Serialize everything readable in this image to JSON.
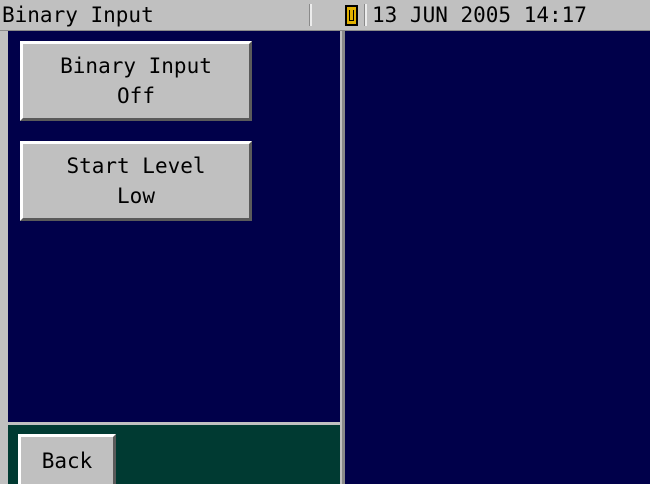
{
  "title_bar": {
    "title": "Binary Input",
    "status_icon": "drive-indicator-icon",
    "datetime": "13 JUN 2005 14:17"
  },
  "menu": {
    "binary_input": {
      "line1": "Binary Input",
      "line2": "Off"
    },
    "start_level": {
      "line1": "Start Level",
      "line2": "Low"
    }
  },
  "softkeys": {
    "back_label": "Back"
  },
  "colors": {
    "panel_background": "#00004a",
    "softkey_bar_background": "#003a32",
    "chrome_gray": "#c0c0c0",
    "status_icon_yellow": "#e0b000"
  }
}
